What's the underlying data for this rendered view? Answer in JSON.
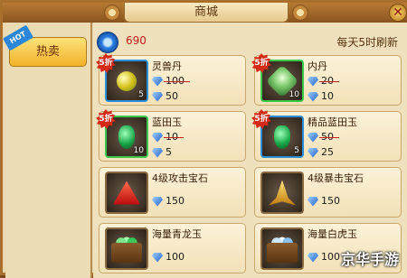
{
  "title": "商城",
  "close_glyph": "✕",
  "sidebar": {
    "tab_label": "热卖",
    "hot_badge": "HOT"
  },
  "header": {
    "balance": "690",
    "refresh_note": "每天5时刷新"
  },
  "items": [
    {
      "name": "灵兽丹",
      "qty": "5",
      "discount": "5折",
      "old_price": "100",
      "price": "50"
    },
    {
      "name": "内丹",
      "qty": "10",
      "discount": "5折",
      "old_price": "20",
      "price": "10"
    },
    {
      "name": "蓝田玉",
      "qty": "10",
      "discount": "5折",
      "old_price": "10",
      "price": "5"
    },
    {
      "name": "精品蓝田玉",
      "qty": "5",
      "discount": "5折",
      "old_price": "50",
      "price": "25"
    },
    {
      "name": "4级攻击宝石",
      "price": "150"
    },
    {
      "name": "4级暴击宝石",
      "price": "150"
    },
    {
      "name": "海量青龙玉",
      "price": "100"
    },
    {
      "name": "海量白虎玉",
      "price": "100"
    }
  ],
  "watermark": "京华手游",
  "colors": {
    "accent": "#f0b22a",
    "price_red": "#c01818",
    "discount": "#d42a18"
  },
  "icons": [
    "close-icon",
    "diamond-icon",
    "hot-badge-icon"
  ]
}
